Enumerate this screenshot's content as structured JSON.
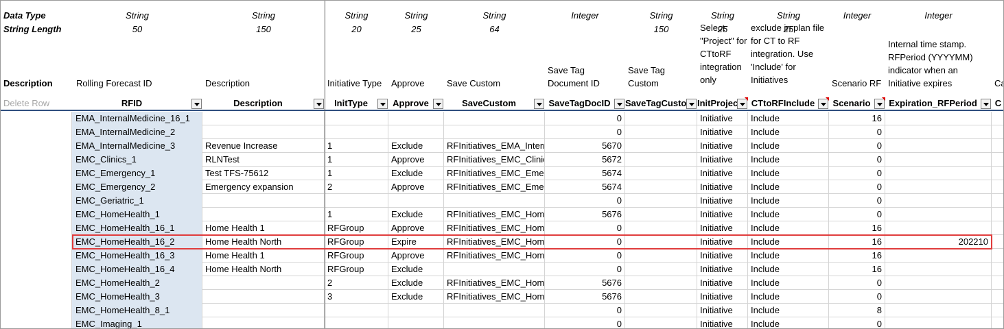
{
  "meta": {
    "data_type_label": "Data Type",
    "string_length_label": "String Length",
    "types": [
      "String",
      "String",
      "String",
      "String",
      "String",
      "Integer",
      "String",
      "String",
      "String",
      "Integer",
      "Integer"
    ],
    "lengths": [
      "50",
      "150",
      "20",
      "25",
      "64",
      "",
      "150",
      "25",
      "25",
      "",
      ""
    ]
  },
  "descriptions": {
    "first": "Description",
    "cols": [
      "Rolling Forecast ID",
      "Description",
      "Initiative Type",
      "Approve",
      "Save Custom",
      "Save Tag Document ID",
      "Save Tag Custom",
      "Select \"Project\" for CTtoRF integration only",
      "exclude in plan file for CT to RF integration. Use 'Include' for Initiatives",
      "Scenario RF",
      "Internal time stamp. RFPeriod (YYYYMM) indicator when an Initiative expires",
      "Ca"
    ]
  },
  "headers": {
    "first": "Delete Row",
    "cols": [
      "RFID",
      "Description",
      "InitType",
      "Approve",
      "SaveCustom",
      "SaveTagDocID",
      "SaveTagCustom",
      "InitProject",
      "CTtoRFInclude",
      "Scenario",
      "Expiration_RFPeriod",
      "C"
    ]
  },
  "rows": [
    [
      "EMA_InternalMedicine_16_1",
      "",
      "",
      "",
      "",
      "0",
      "",
      "Initiative",
      "Include",
      "16",
      ""
    ],
    [
      "EMA_InternalMedicine_2",
      "",
      "",
      "",
      "",
      "0",
      "",
      "Initiative",
      "Include",
      "0",
      ""
    ],
    [
      "EMA_InternalMedicine_3",
      "Revenue Increase",
      "1",
      "Exclude",
      "RFInitiatives_EMA_InternalMedicine_3",
      "5670",
      "",
      "Initiative",
      "Include",
      "0",
      ""
    ],
    [
      "EMC_Clinics_1",
      "RLNTest",
      "1",
      "Approve",
      "RFInitiatives_EMC_Clinics_1",
      "5672",
      "",
      "Initiative",
      "Include",
      "0",
      ""
    ],
    [
      "EMC_Emergency_1",
      "Test TFS-75612",
      "1",
      "Exclude",
      "RFInitiatives_EMC_Emergency_1",
      "5674",
      "",
      "Initiative",
      "Include",
      "0",
      ""
    ],
    [
      "EMC_Emergency_2",
      "Emergency expansion",
      "2",
      "Approve",
      "RFInitiatives_EMC_Emergency_2",
      "5674",
      "",
      "Initiative",
      "Include",
      "0",
      ""
    ],
    [
      "EMC_Geriatric_1",
      "",
      "",
      "",
      "",
      "0",
      "",
      "Initiative",
      "Include",
      "0",
      ""
    ],
    [
      "EMC_HomeHealth_1",
      "",
      "1",
      "Exclude",
      "RFInitiatives_EMC_HomeHealth_1",
      "5676",
      "",
      "Initiative",
      "Include",
      "0",
      ""
    ],
    [
      "EMC_HomeHealth_16_1",
      "Home Health 1",
      "RFGroup",
      "Approve",
      "RFInitiatives_EMC_HomeHealth_16_1",
      "0",
      "",
      "Initiative",
      "Include",
      "16",
      ""
    ],
    [
      "EMC_HomeHealth_16_2",
      "Home Health North",
      "RFGroup",
      "Expire",
      "RFInitiatives_EMC_HomeHealth_16_2",
      "0",
      "",
      "Initiative",
      "Include",
      "16",
      "202210"
    ],
    [
      "EMC_HomeHealth_16_3",
      "Home Health 1",
      "RFGroup",
      "Approve",
      "RFInitiatives_EMC_HomeHealth_16_3",
      "0",
      "",
      "Initiative",
      "Include",
      "16",
      ""
    ],
    [
      "EMC_HomeHealth_16_4",
      "Home Health North",
      "RFGroup",
      "Exclude",
      "",
      "0",
      "",
      "Initiative",
      "Include",
      "16",
      ""
    ],
    [
      "EMC_HomeHealth_2",
      "",
      "2",
      "Exclude",
      "RFInitiatives_EMC_HomeHealth_2",
      "5676",
      "",
      "Initiative",
      "Include",
      "0",
      ""
    ],
    [
      "EMC_HomeHealth_3",
      "",
      "3",
      "Exclude",
      "RFInitiatives_EMC_HomeHealth_3",
      "5676",
      "",
      "Initiative",
      "Include",
      "0",
      ""
    ],
    [
      "EMC_HomeHealth_8_1",
      "",
      "",
      "",
      "",
      "0",
      "",
      "Initiative",
      "Include",
      "8",
      ""
    ],
    [
      "EMC_Imaging_1",
      "",
      "",
      "",
      "",
      "0",
      "",
      "Initiative",
      "Include",
      "0",
      ""
    ]
  ],
  "colors": {
    "rfid_fill": "#dce6f1",
    "highlight_border": "#e03c3c",
    "header_rule": "#2f4f7f",
    "comment_marker": "#e00000"
  }
}
